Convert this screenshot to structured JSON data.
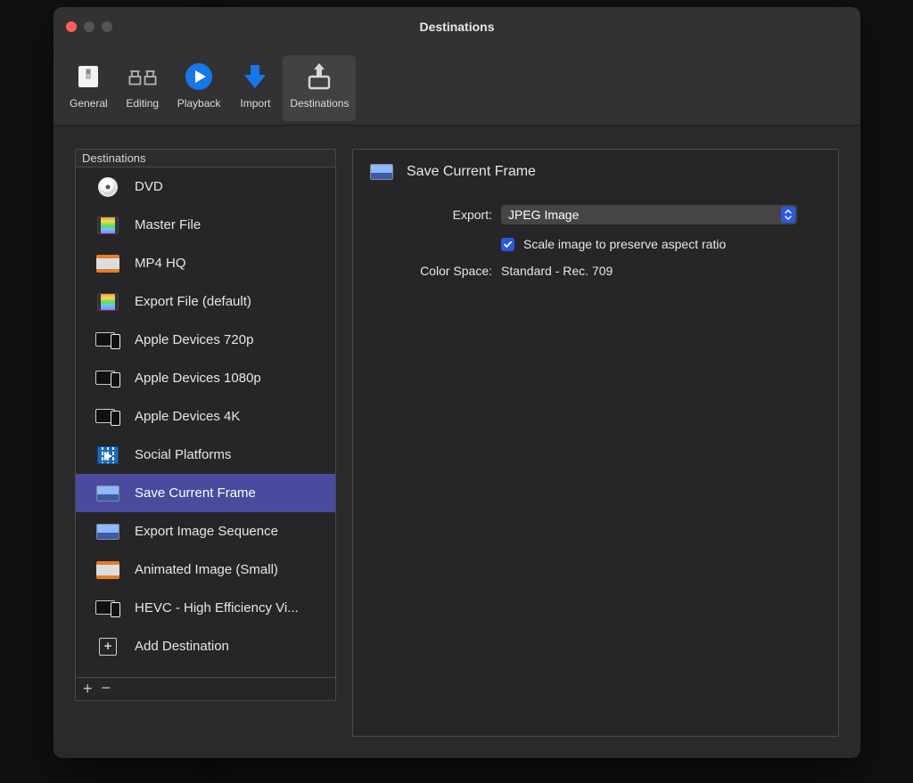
{
  "window": {
    "title": "Destinations"
  },
  "toolbar": {
    "items": [
      {
        "label": "General"
      },
      {
        "label": "Editing"
      },
      {
        "label": "Playback"
      },
      {
        "label": "Import"
      },
      {
        "label": "Destinations"
      }
    ],
    "selected_index": 4
  },
  "sidebar": {
    "header": "Destinations",
    "items": [
      {
        "label": "DVD",
        "icon": "dvd"
      },
      {
        "label": "Master File",
        "icon": "film"
      },
      {
        "label": "MP4 HQ",
        "icon": "envelope"
      },
      {
        "label": "Export File (default)",
        "icon": "film"
      },
      {
        "label": "Apple Devices 720p",
        "icon": "devices"
      },
      {
        "label": "Apple Devices 1080p",
        "icon": "devices"
      },
      {
        "label": "Apple Devices 4K",
        "icon": "devices"
      },
      {
        "label": "Social Platforms",
        "icon": "social"
      },
      {
        "label": "Save Current Frame",
        "icon": "frame"
      },
      {
        "label": "Export Image Sequence",
        "icon": "frame"
      },
      {
        "label": "Animated Image (Small)",
        "icon": "envelope"
      },
      {
        "label": "HEVC - High Efficiency Vi...",
        "icon": "devices"
      },
      {
        "label": "Add Destination",
        "icon": "plus"
      }
    ],
    "selected_index": 8
  },
  "detail": {
    "title": "Save Current Frame",
    "export_label": "Export:",
    "export_value": "JPEG Image",
    "scale_checked": true,
    "scale_label": "Scale image to preserve aspect ratio",
    "color_space_label": "Color Space:",
    "color_space_value": "Standard - Rec. 709"
  }
}
